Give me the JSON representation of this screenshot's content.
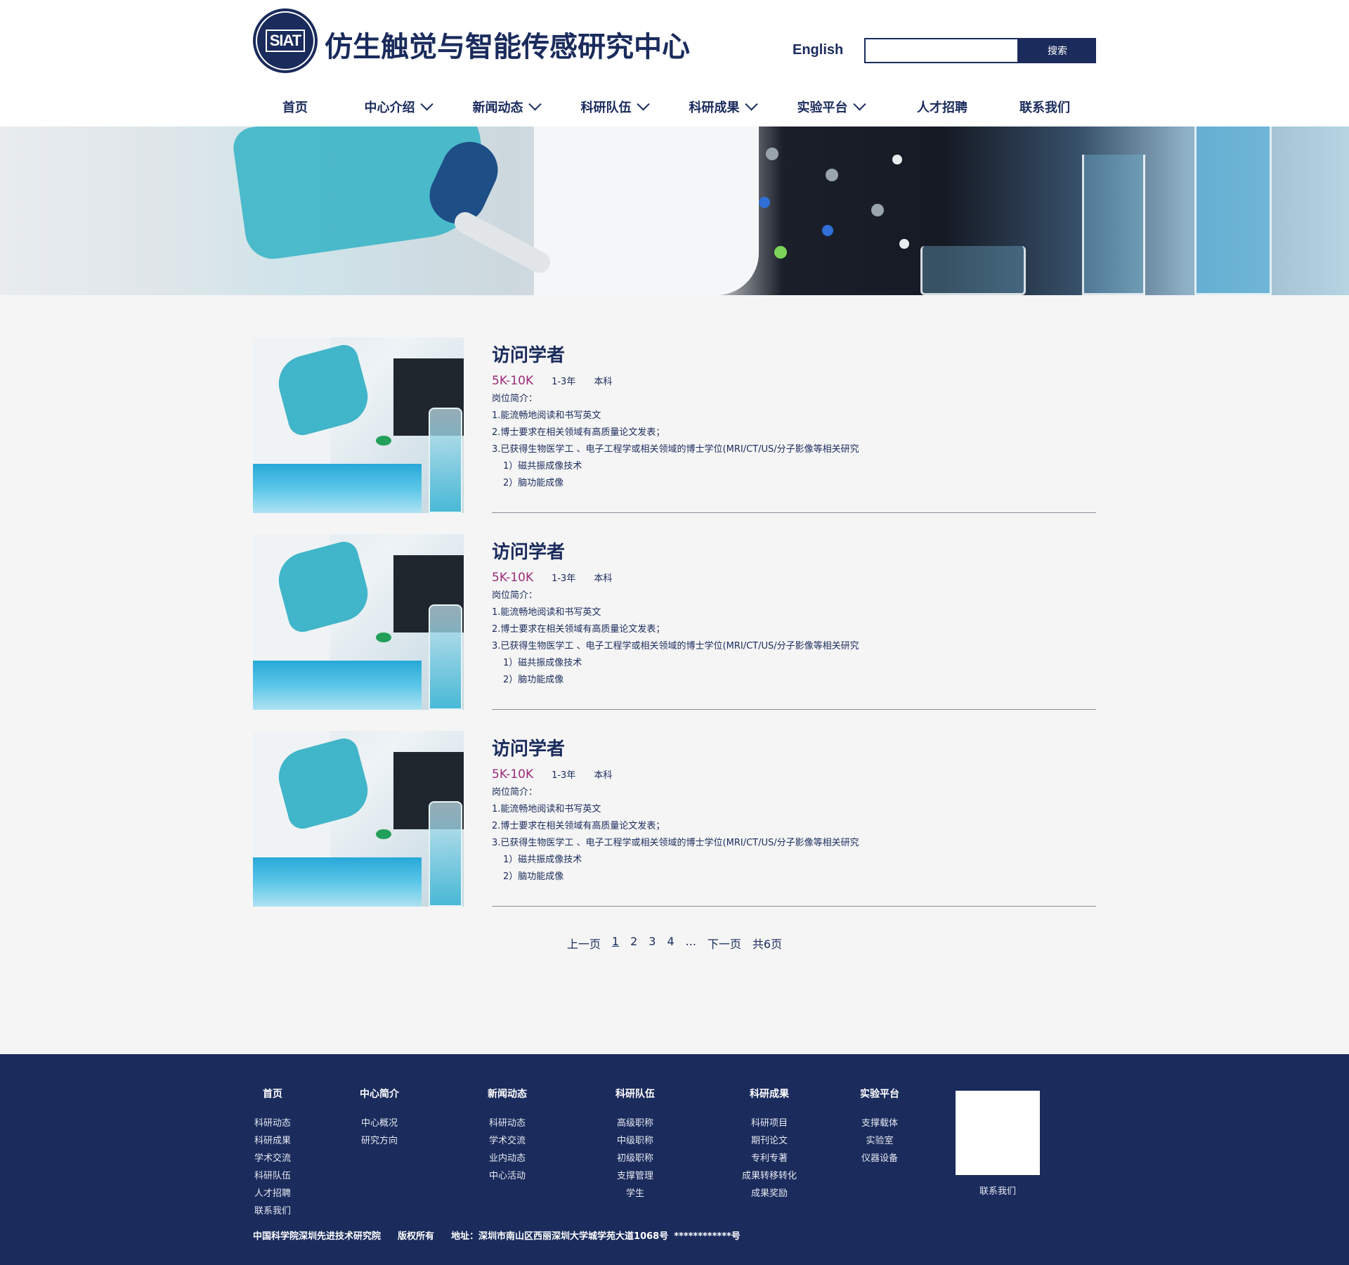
{
  "header": {
    "logo_text": "SIAT",
    "site_title": "仿生触觉与智能传感研究中心",
    "lang_link": "English",
    "search": {
      "placeholder": "",
      "button": "搜索"
    }
  },
  "nav": [
    {
      "label": "首页",
      "dropdown": false
    },
    {
      "label": "中心介绍",
      "dropdown": true
    },
    {
      "label": "新闻动态",
      "dropdown": true
    },
    {
      "label": "科研队伍",
      "dropdown": true
    },
    {
      "label": "科研成果",
      "dropdown": true
    },
    {
      "label": "实验平台",
      "dropdown": true
    },
    {
      "label": "人才招聘",
      "dropdown": false
    },
    {
      "label": "联系我们",
      "dropdown": false
    }
  ],
  "jobs": [
    {
      "title": "访问学者",
      "salary": "5K-10K",
      "experience": "1-3年",
      "education": "本科",
      "intro_label": "岗位简介：",
      "lines": [
        "1.能流畅地阅读和书写英文",
        "2.博士要求在相关领域有高质量论文发表；",
        "3.已获得生物医学工 、电子工程学或相关领域的博士学位(MRI/CT/US/分子影像等相关研究"
      ],
      "sub_lines": [
        "1）磁共振成像技术",
        "2）脑功能成像"
      ]
    },
    {
      "title": "访问学者",
      "salary": "5K-10K",
      "experience": "1-3年",
      "education": "本科",
      "intro_label": "岗位简介：",
      "lines": [
        "1.能流畅地阅读和书写英文",
        "2.博士要求在相关领域有高质量论文发表；",
        "3.已获得生物医学工 、电子工程学或相关领域的博士学位(MRI/CT/US/分子影像等相关研究"
      ],
      "sub_lines": [
        "1）磁共振成像技术",
        "2）脑功能成像"
      ]
    },
    {
      "title": "访问学者",
      "salary": "5K-10K",
      "experience": "1-3年",
      "education": "本科",
      "intro_label": "岗位简介：",
      "lines": [
        "1.能流畅地阅读和书写英文",
        "2.博士要求在相关领域有高质量论文发表；",
        "3.已获得生物医学工 、电子工程学或相关领域的博士学位(MRI/CT/US/分子影像等相关研究"
      ],
      "sub_lines": [
        "1）磁共振成像技术",
        "2）脑功能成像"
      ]
    }
  ],
  "pager": {
    "prev": "上一页",
    "pages": [
      "1",
      "2",
      "3",
      "4"
    ],
    "current": "1",
    "ellipsis": "...",
    "next": "下一页",
    "total": "共6页"
  },
  "footer": {
    "columns": [
      {
        "head": "首页",
        "links": [
          "科研动态",
          "科研成果",
          "学术交流",
          "科研队伍",
          "人才招聘",
          "联系我们"
        ]
      },
      {
        "head": "中心简介",
        "links": [
          "中心概况",
          "研究方向"
        ]
      },
      {
        "head": "新闻动态",
        "links": [
          "科研动态",
          "学术交流",
          "业内动态",
          "中心活动"
        ]
      },
      {
        "head": "科研队伍",
        "links": [
          "高级职称",
          "中级职称",
          "初级职称",
          "支撑管理",
          "学生"
        ]
      },
      {
        "head": "科研成果",
        "links": [
          "科研项目",
          "期刊论文",
          "专利专著",
          "成果转移转化",
          "成果奖励"
        ]
      },
      {
        "head": "实验平台",
        "links": [
          "支撑载体",
          "实验室",
          "仪器设备"
        ]
      }
    ],
    "qr_label": "联系我们",
    "copyright": {
      "org": "中国科学院深圳先进技术研究院",
      "rights": "版权所有",
      "address": "地址：深圳市南山区西丽深圳大学城学苑大道1068号",
      "icp": "************号"
    }
  },
  "colors": {
    "brand": "#1a2b5c",
    "salary": "#9b2b7a",
    "content_bg": "#f5f5f5"
  }
}
